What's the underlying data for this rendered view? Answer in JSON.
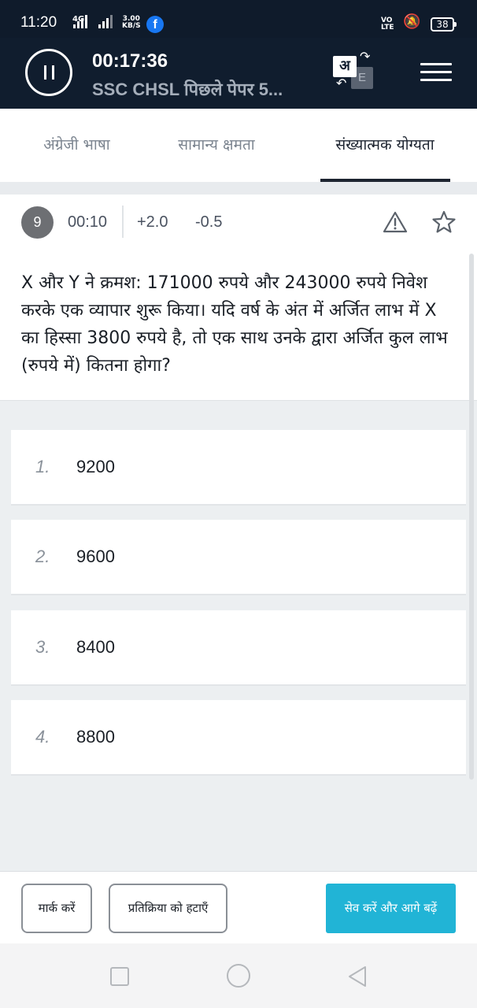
{
  "status_bar": {
    "time": "11:20",
    "network": "4G",
    "speed_value": "3.00",
    "speed_unit": "KB/S",
    "volte": "VO LTE",
    "battery": "38"
  },
  "header": {
    "timer": "00:17:36",
    "title": "SSC CHSL पिछले पेपर 5...",
    "lang_primary": "अ",
    "lang_secondary": "E",
    "pause_icon": "pause-icon",
    "menu_icon": "hamburger-menu-icon"
  },
  "tabs": [
    {
      "label": "अंग्रेजी भाषा",
      "active": false
    },
    {
      "label": "सामान्य क्षमता",
      "active": false
    },
    {
      "label": "संख्यात्मक योग्यता",
      "active": true
    }
  ],
  "question_meta": {
    "number": "9",
    "time": "00:10",
    "positive_marks": "+2.0",
    "negative_marks": "-0.5",
    "report_icon": "warning-icon",
    "bookmark_icon": "star-icon"
  },
  "question": {
    "text": "X और Y ने क्रमश: 171000 रुपये और 243000 रुपये निवेश करके एक व्यापार शुरू किया। यदि वर्ष के अंत में अर्जित लाभ में X का हिस्सा 3800 रुपये है, तो एक साथ उनके द्वारा अर्जित कुल लाभ (रुपये में) कितना होगा?"
  },
  "options": [
    {
      "num": "1.",
      "value": "9200"
    },
    {
      "num": "2.",
      "value": "9600"
    },
    {
      "num": "3.",
      "value": "8400"
    },
    {
      "num": "4.",
      "value": "8800"
    }
  ],
  "actions": {
    "mark": "मार्क करें",
    "clear": "प्रतिक्रिया को हटाएँ",
    "save_next": "सेव करें और आगे बढ़ें"
  },
  "colors": {
    "header_bg": "#101d2e",
    "primary_button": "#21b4d6",
    "facebook": "#1877f2"
  }
}
